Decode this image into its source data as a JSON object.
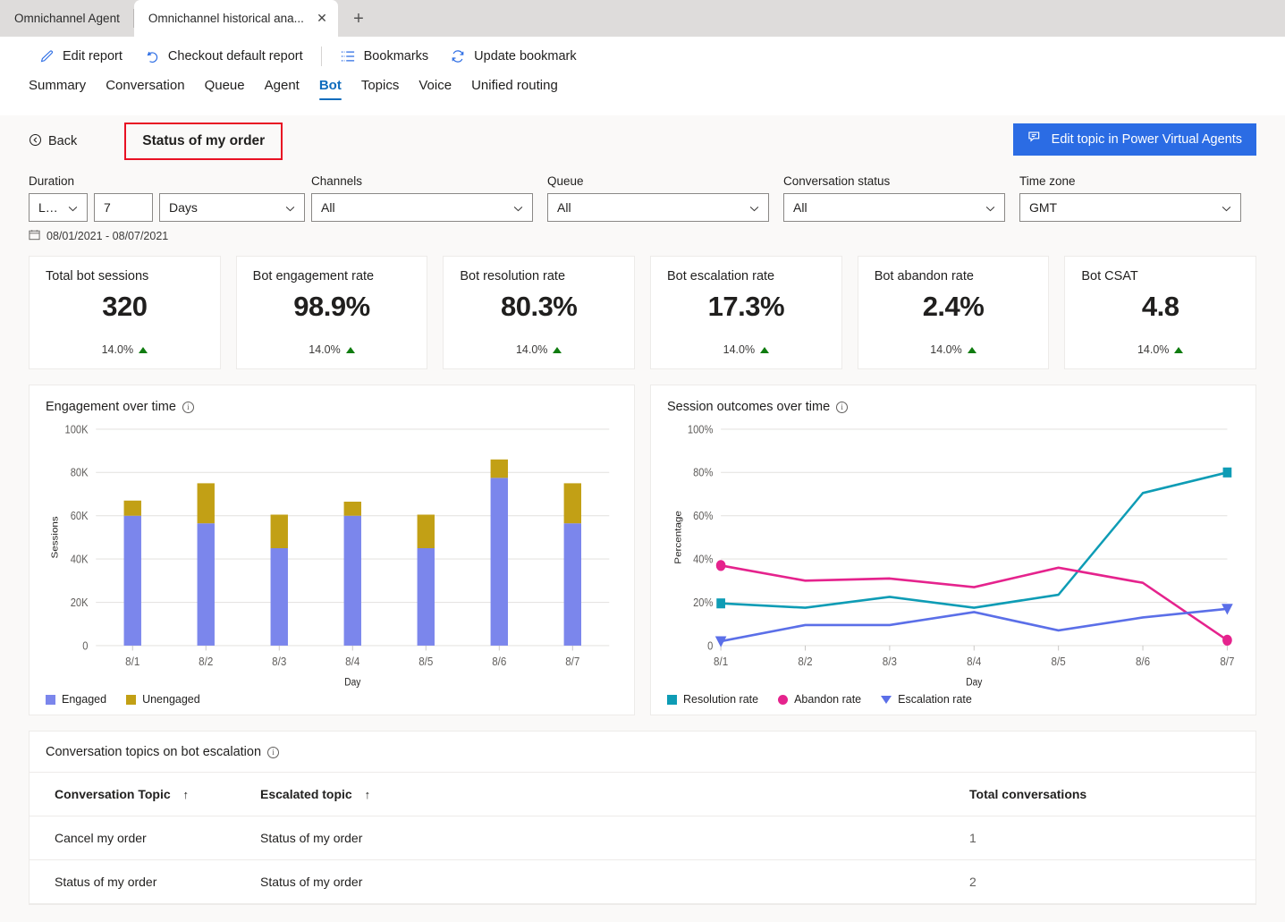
{
  "browser": {
    "tabs": [
      {
        "title": "Omnichannel Agent",
        "active": false
      },
      {
        "title": "Omnichannel historical ana...",
        "active": true
      }
    ],
    "close_label": "✕",
    "newtab_label": "+"
  },
  "toolbar": {
    "items": [
      {
        "label": "Edit report",
        "icon": "pencil-icon"
      },
      {
        "label": "Checkout default report",
        "icon": "undo-icon"
      },
      {
        "label": "Bookmarks",
        "icon": "bookmarks-list-icon"
      },
      {
        "label": "Update bookmark",
        "icon": "refresh-icon"
      }
    ]
  },
  "pivot": {
    "tabs": [
      "Summary",
      "Conversation",
      "Queue",
      "Agent",
      "Bot",
      "Topics",
      "Voice",
      "Unified routing"
    ],
    "selected": "Bot"
  },
  "header": {
    "back_label": "Back",
    "page_title": "Status of my order",
    "primary_button": "Edit topic in Power Virtual Agents",
    "primary_button_color": "#2b6ce4",
    "highlight_color": "#e81123"
  },
  "filters": {
    "duration": {
      "label": "Duration",
      "relation": "Last",
      "amount": "7",
      "unit": "Days"
    },
    "channels": {
      "label": "Channels",
      "value": "All"
    },
    "queue": {
      "label": "Queue",
      "value": "All"
    },
    "conversation_status": {
      "label": "Conversation status",
      "value": "All"
    },
    "time_zone": {
      "label": "Time zone",
      "value": "GMT"
    },
    "date_range": "08/01/2021 - 08/07/2021"
  },
  "kpis": [
    {
      "title": "Total bot sessions",
      "value": "320",
      "delta": "14.0%",
      "trend": "up"
    },
    {
      "title": "Bot engagement rate",
      "value": "98.9%",
      "delta": "14.0%",
      "trend": "up"
    },
    {
      "title": "Bot resolution rate",
      "value": "80.3%",
      "delta": "14.0%",
      "trend": "up"
    },
    {
      "title": "Bot escalation rate",
      "value": "17.3%",
      "delta": "14.0%",
      "trend": "up"
    },
    {
      "title": "Bot abandon rate",
      "value": "2.4%",
      "delta": "14.0%",
      "trend": "up"
    },
    {
      "title": "Bot CSAT",
      "value": "4.8",
      "delta": "14.0%",
      "trend": "up"
    }
  ],
  "chart_data": [
    {
      "type": "bar",
      "stacked": true,
      "title": "Engagement over time",
      "xlabel": "Day",
      "ylabel": "Sessions",
      "categories": [
        "8/1",
        "8/2",
        "8/3",
        "8/4",
        "8/5",
        "8/6",
        "8/7"
      ],
      "ytick_labels": [
        "0",
        "20K",
        "40K",
        "60K",
        "80K",
        "100K"
      ],
      "ytick_values": [
        0,
        20000,
        40000,
        60000,
        80000,
        100000
      ],
      "ylim": [
        0,
        100000
      ],
      "grid": true,
      "legend_position": "bottom",
      "series": [
        {
          "name": "Engaged",
          "color": "#7b86ec",
          "values": [
            60000,
            56500,
            45000,
            60000,
            45000,
            77500,
            56500
          ]
        },
        {
          "name": "Unengaged",
          "color": "#c2a015",
          "values": [
            7000,
            18500,
            15500,
            6500,
            15500,
            8500,
            18500
          ]
        }
      ]
    },
    {
      "type": "line",
      "title": "Session outcomes over time",
      "xlabel": "Day",
      "ylabel": "Percentage",
      "categories": [
        "8/1",
        "8/2",
        "8/3",
        "8/4",
        "8/5",
        "8/6",
        "8/7"
      ],
      "ytick_labels": [
        "0",
        "20%",
        "40%",
        "60%",
        "80%",
        "100%"
      ],
      "ytick_values": [
        0,
        20,
        40,
        60,
        80,
        100
      ],
      "ylim": [
        0,
        100
      ],
      "grid": true,
      "legend_position": "bottom",
      "series": [
        {
          "name": "Resolution rate",
          "color": "#0e9cb5",
          "marker": "square",
          "values": [
            19.5,
            17.5,
            22.5,
            17.5,
            23.5,
            70.5,
            80.0
          ]
        },
        {
          "name": "Abandon rate",
          "color": "#e5238d",
          "marker": "circle",
          "values": [
            37.0,
            30.0,
            31.0,
            27.0,
            36.0,
            29.0,
            2.5
          ]
        },
        {
          "name": "Escalation rate",
          "color": "#5b6fe8",
          "marker": "triangle",
          "values": [
            2.0,
            9.5,
            9.5,
            15.5,
            7.0,
            13.0,
            17.0
          ]
        }
      ]
    }
  ],
  "table": {
    "title": "Conversation topics on bot escalation",
    "columns": [
      {
        "label": "Conversation Topic",
        "sort": "↑"
      },
      {
        "label": "Escalated topic",
        "sort": "↑"
      },
      {
        "label": "Total conversations",
        "sort": ""
      }
    ],
    "rows": [
      [
        "Cancel my order",
        "Status of my order",
        "1"
      ],
      [
        "Status of my order",
        "Status of my order",
        "2"
      ]
    ]
  }
}
